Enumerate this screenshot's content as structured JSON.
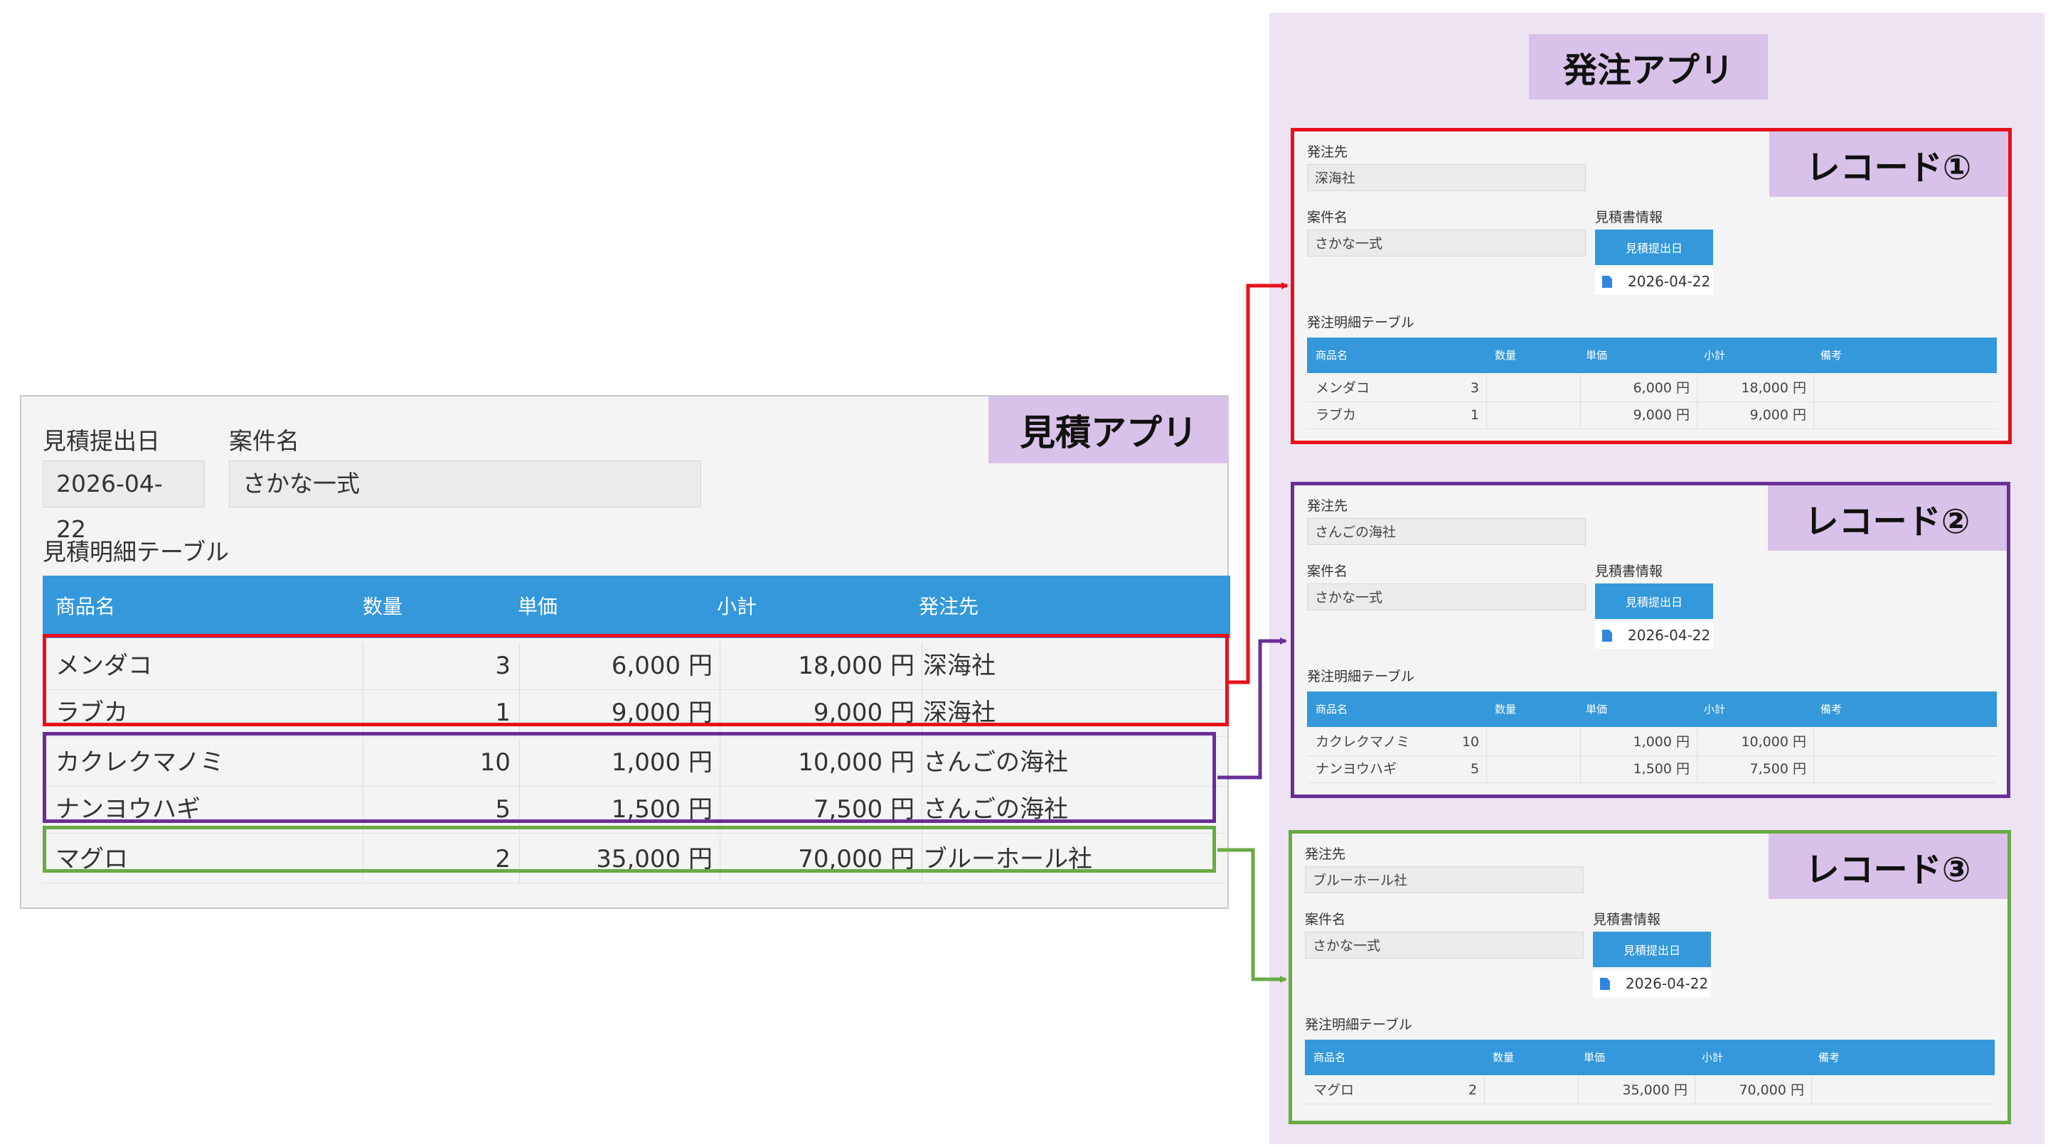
{
  "colors": {
    "accent_blue": "#3498db",
    "record1_border": "#e8101a",
    "record2_border": "#6a2f96",
    "record3_border": "#6aaa44",
    "tag_purple": "#d9c2e9",
    "panel_purple": "#ede3f3"
  },
  "estimate_app": {
    "tag": "見積アプリ",
    "date_label": "見積提出日",
    "date_value": "2026-04-22",
    "case_label": "案件名",
    "case_value": "さかな一式",
    "table_title": "見積明細テーブル",
    "headers": [
      "商品名",
      "数量",
      "単価",
      "小計",
      "発注先"
    ],
    "rows": [
      {
        "name": "メンダコ",
        "qty": "3",
        "price": "6,000 円",
        "subtotal": "18,000 円",
        "supplier": "深海社"
      },
      {
        "name": "ラブカ",
        "qty": "1",
        "price": "9,000 円",
        "subtotal": "9,000 円",
        "supplier": "深海社"
      },
      {
        "name": "カクレクマノミ",
        "qty": "10",
        "price": "1,000 円",
        "subtotal": "10,000 円",
        "supplier": "さんごの海社"
      },
      {
        "name": "ナンヨウハギ",
        "qty": "5",
        "price": "1,500 円",
        "subtotal": "7,500 円",
        "supplier": "さんごの海社"
      },
      {
        "name": "マグロ",
        "qty": "2",
        "price": "35,000 円",
        "subtotal": "70,000 円",
        "supplier": "ブルーホール社"
      }
    ]
  },
  "order_app": {
    "tag": "発注アプリ",
    "records": [
      {
        "tag": "レコード①",
        "supplier_label": "発注先",
        "supplier": "深海社",
        "case_label": "案件名",
        "case": "さかな一式",
        "estimate_label": "見積書情報",
        "estimate_button": "見積提出日",
        "estimate_date": "2026-04-22",
        "table_title": "発注明細テーブル",
        "headers": [
          "商品名",
          "数量",
          "単価",
          "小計",
          "備考"
        ],
        "rows": [
          {
            "name": "メンダコ",
            "qty": "3",
            "price": "6,000 円",
            "subtotal": "18,000 円",
            "note": ""
          },
          {
            "name": "ラブカ",
            "qty": "1",
            "price": "9,000 円",
            "subtotal": "9,000 円",
            "note": ""
          }
        ]
      },
      {
        "tag": "レコード②",
        "supplier_label": "発注先",
        "supplier": "さんごの海社",
        "case_label": "案件名",
        "case": "さかな一式",
        "estimate_label": "見積書情報",
        "estimate_button": "見積提出日",
        "estimate_date": "2026-04-22",
        "table_title": "発注明細テーブル",
        "headers": [
          "商品名",
          "数量",
          "単価",
          "小計",
          "備考"
        ],
        "rows": [
          {
            "name": "カクレクマノミ",
            "qty": "10",
            "price": "1,000 円",
            "subtotal": "10,000 円",
            "note": ""
          },
          {
            "name": "ナンヨウハギ",
            "qty": "5",
            "price": "1,500 円",
            "subtotal": "7,500 円",
            "note": ""
          }
        ]
      },
      {
        "tag": "レコード③",
        "supplier_label": "発注先",
        "supplier": "ブルーホール社",
        "case_label": "案件名",
        "case": "さかな一式",
        "estimate_label": "見積書情報",
        "estimate_button": "見積提出日",
        "estimate_date": "2026-04-22",
        "table_title": "発注明細テーブル",
        "headers": [
          "商品名",
          "数量",
          "単価",
          "小計",
          "備考"
        ],
        "rows": [
          {
            "name": "マグロ",
            "qty": "2",
            "price": "35,000 円",
            "subtotal": "70,000 円",
            "note": ""
          }
        ]
      }
    ]
  }
}
